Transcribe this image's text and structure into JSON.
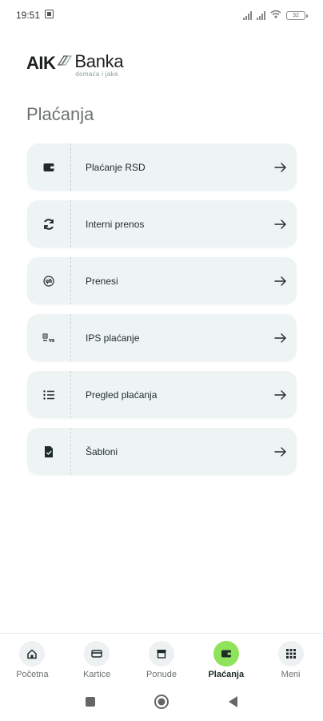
{
  "status": {
    "time": "19:51",
    "battery": "32"
  },
  "logo": {
    "brand_left": "AIK",
    "brand_right": "Banka",
    "tagline": "domaća i jaka"
  },
  "page": {
    "title": "Plaćanja"
  },
  "menu": [
    {
      "label": "Plaćanje RSD",
      "icon": "wallet-icon"
    },
    {
      "label": "Interni prenos",
      "icon": "refresh-icon"
    },
    {
      "label": "Prenesi",
      "icon": "exchange-icon"
    },
    {
      "label": "IPS plaćanje",
      "icon": "qr-pay-icon"
    },
    {
      "label": "Pregled plaćanja",
      "icon": "list-icon"
    },
    {
      "label": "Šabloni",
      "icon": "document-check-icon"
    }
  ],
  "bottom_nav": [
    {
      "label": "Početna",
      "icon": "home-icon",
      "active": false
    },
    {
      "label": "Kartice",
      "icon": "card-icon",
      "active": false
    },
    {
      "label": "Ponude",
      "icon": "store-icon",
      "active": false
    },
    {
      "label": "Plaćanja",
      "icon": "wallet-icon",
      "active": true
    },
    {
      "label": "Meni",
      "icon": "grid-icon",
      "active": false
    }
  ],
  "colors": {
    "accent": "#8fe35a",
    "row_bg": "#eef4f4",
    "text": "#1f2a2a",
    "muted": "#6b7272"
  }
}
